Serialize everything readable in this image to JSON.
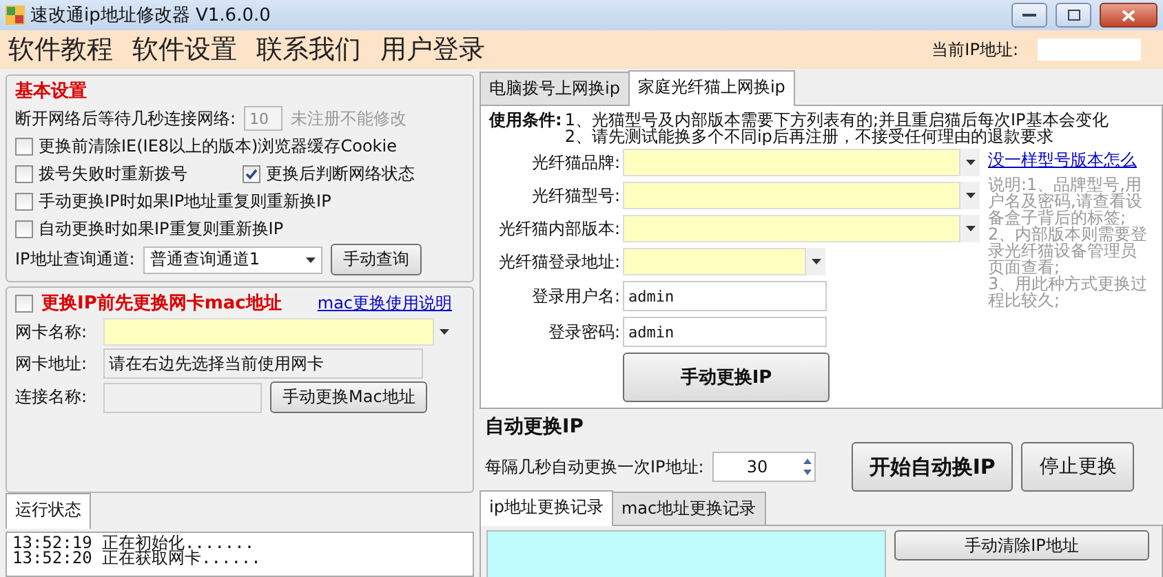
{
  "window": {
    "title": "速改通ip地址修改器 V1.6.0.0"
  },
  "menu": [
    {
      "label": "软件教程"
    },
    {
      "label": "软件设置"
    },
    {
      "label": "联系我们"
    },
    {
      "label": "用户登录"
    }
  ],
  "current_ip": {
    "label": "当前IP地址:"
  },
  "basic_settings": {
    "title": "基本设置",
    "wait_label": "断开网络后等待几秒连接网络:",
    "wait_value": "10",
    "wait_note": "未注册不能修改",
    "option_rows": [
      {
        "options": [
          {
            "label": "更换前清除IE(IE8以上的版本)浏览器缓存Cookie",
            "checked": false
          }
        ]
      },
      {
        "options": [
          {
            "label": "拨号失败时重新拨号",
            "checked": false
          },
          {
            "label": "更换后判断网络状态",
            "checked": true
          }
        ]
      },
      {
        "options": [
          {
            "label": "手动更换IP时如果IP地址重复则重新换IP",
            "checked": false
          }
        ]
      },
      {
        "options": [
          {
            "label": "自动更换时如果IP重复则重新换IP",
            "checked": false
          }
        ]
      }
    ],
    "channel_label": "IP地址查询通道:",
    "channel_value": "普通查询通道1",
    "query_button": "手动查询"
  },
  "mac_settings": {
    "label": "更换IP前先更换网卡mac地址",
    "checked": false,
    "help_link": "mac更换使用说明",
    "nic_name_label": "网卡名称:",
    "nic_address_label": "网卡地址:",
    "nic_address_value": "请在右边先选择当前使用网卡",
    "connection_label": "连接名称:",
    "change_button": "手动更换Mac地址"
  },
  "status_log": {
    "tab": "运行状态",
    "lines": [
      {
        "time": "13:52:19",
        "message": "正在初始化......."
      },
      {
        "time": "13:52:20",
        "message": "正在获取网卡......"
      }
    ]
  },
  "modem_tabs": [
    {
      "label": "电脑拨号上网换ip",
      "selected": false
    },
    {
      "label": "家庭光纤猫上网换ip",
      "selected": true
    }
  ],
  "modem_panel": {
    "conditions_label": "使用条件:",
    "conditions": [
      "1、光猫型号及内部版本需要下方列表有的;并且重启猫后每次IP基本会变化",
      "2、请先测试能换多个不同ip后再注册，不接受任何理由的退款要求"
    ],
    "fields": [
      {
        "label": "光纤猫品牌:",
        "kind": "dropdown"
      },
      {
        "label": "光纤猫型号:",
        "kind": "dropdown"
      },
      {
        "label": "光纤猫内部版本:",
        "kind": "dropdown"
      },
      {
        "label": "光纤猫登录地址:",
        "kind": "shortdropdown"
      },
      {
        "label": "登录用户名:",
        "kind": "text",
        "value": "admin"
      },
      {
        "label": "登录密码:",
        "kind": "text",
        "value": "admin"
      }
    ],
    "help_link": "没一样型号版本怎么",
    "notes": [
      "说明:1、品牌型号,用户名及密码,请查看设备盒子背后的标签;",
      "2、内部版本则需要登录光纤猫设备管理员页面查看;",
      "3、用此种方式更换过程比较久;"
    ],
    "change_button": "手动更换IP"
  },
  "auto_change": {
    "title": "自动更换IP",
    "interval_label": "每隔几秒自动更换一次IP地址:",
    "interval_value": "30",
    "start_button": "开始自动换IP",
    "stop_button": "停止更换"
  },
  "log_tabs": [
    {
      "label": "ip地址更换记录",
      "selected": true
    },
    {
      "label": "mac地址更换记录",
      "selected": false
    }
  ],
  "clear_button": "手动清除IP地址"
}
